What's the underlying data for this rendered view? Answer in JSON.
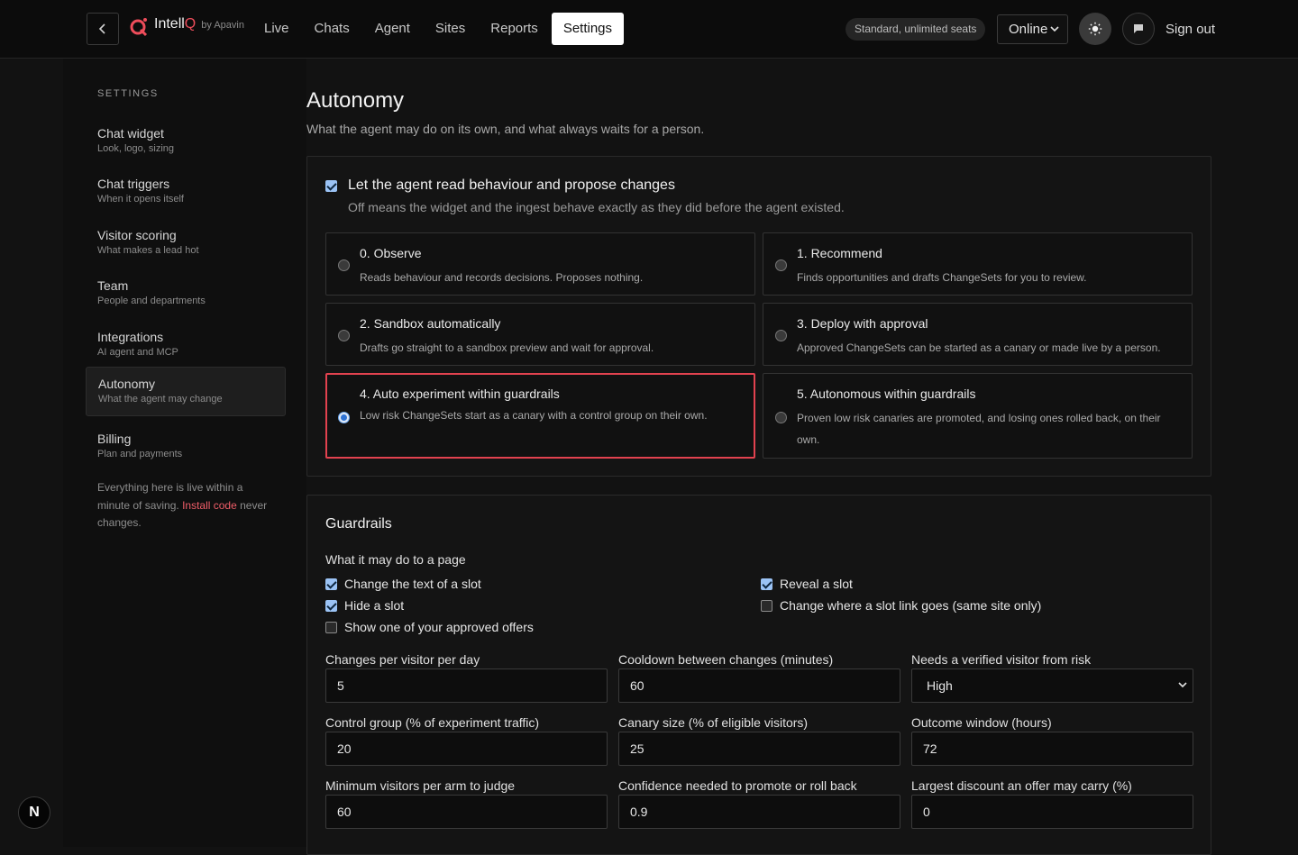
{
  "header": {
    "brand_name_pre": "Intell",
    "brand_name_q": "Q",
    "brand_by": "by Apavin",
    "nav": [
      "Live",
      "Chats",
      "Agent",
      "Sites",
      "Reports",
      "Settings"
    ],
    "active_nav": "Settings",
    "plan_badge": "Standard, unlimited seats",
    "status_value": "Online",
    "sign_out": "Sign out"
  },
  "sidebar": {
    "heading": "SETTINGS",
    "items": [
      {
        "label": "Chat widget",
        "sub": "Look, logo, sizing"
      },
      {
        "label": "Chat triggers",
        "sub": "When it opens itself"
      },
      {
        "label": "Visitor scoring",
        "sub": "What makes a lead hot"
      },
      {
        "label": "Team",
        "sub": "People and departments"
      },
      {
        "label": "Integrations",
        "sub": "AI agent and MCP"
      },
      {
        "label": "Autonomy",
        "sub": "What the agent may change"
      },
      {
        "label": "Billing",
        "sub": "Plan and payments"
      }
    ],
    "active_item": "Autonomy",
    "note_pre": "Everything here is live within a minute of saving.",
    "note_link": "Install code",
    "note_post": "never changes.",
    "corner_badge": "N"
  },
  "main": {
    "title": "Autonomy",
    "subtitle": "What the agent may do on its own, and what always waits for a person.",
    "master_toggle": {
      "label": "Let the agent read behaviour and propose changes",
      "checked": true,
      "sub": "Off means the widget and the ingest behave exactly as they did before the agent existed."
    },
    "levels": [
      {
        "title": "0. Observe",
        "desc": "Reads behaviour and records decisions. Proposes nothing."
      },
      {
        "title": "1. Recommend",
        "desc": "Finds opportunities and drafts ChangeSets for you to review."
      },
      {
        "title": "2. Sandbox automatically",
        "desc": "Drafts go straight to a sandbox preview and wait for approval."
      },
      {
        "title": "3. Deploy with approval",
        "desc": "Approved ChangeSets can be started as a canary or made live by a person."
      },
      {
        "title": "4. Auto experiment within guardrails",
        "desc": "Low risk ChangeSets start as a canary with a control group on their own."
      },
      {
        "title": "5. Autonomous within guardrails",
        "desc": "Proven low risk canaries are promoted, and losing ones rolled back, on their own."
      }
    ],
    "selected_level": 4,
    "guardrails": {
      "title": "Guardrails",
      "page_actions_label": "What it may do to a page",
      "options": [
        {
          "label": "Change the text of a slot",
          "checked": true
        },
        {
          "label": "Reveal a slot",
          "checked": true
        },
        {
          "label": "Hide a slot",
          "checked": true
        },
        {
          "label": "Change where a slot link goes (same site only)",
          "checked": false
        },
        {
          "label": "Show one of your approved offers",
          "checked": false
        }
      ],
      "fields": [
        {
          "label": "Changes per visitor per day",
          "value": "5"
        },
        {
          "label": "Cooldown between changes (minutes)",
          "value": "60"
        },
        {
          "label": "Needs a verified visitor from risk",
          "value": "High",
          "type": "select"
        },
        {
          "label": "Control group (% of experiment traffic)",
          "value": "20"
        },
        {
          "label": "Canary size (% of eligible visitors)",
          "value": "25"
        },
        {
          "label": "Outcome window (hours)",
          "value": "72"
        },
        {
          "label": "Minimum visitors per arm to judge",
          "value": "60"
        },
        {
          "label": "Confidence needed to promote or roll back",
          "value": "0.9"
        },
        {
          "label": "Largest discount an offer may carry (%)",
          "value": "0"
        }
      ]
    }
  },
  "colors": {
    "accent_red": "#e2424f",
    "checkbox_blue": "#9bc3f5",
    "background": "#121212"
  },
  "icons": [
    "chevron-left-icon",
    "intellq-logo-icon",
    "chevron-down-icon",
    "sun-icon",
    "chat-bubble-icon",
    "radio-icon",
    "checkbox-icon"
  ]
}
